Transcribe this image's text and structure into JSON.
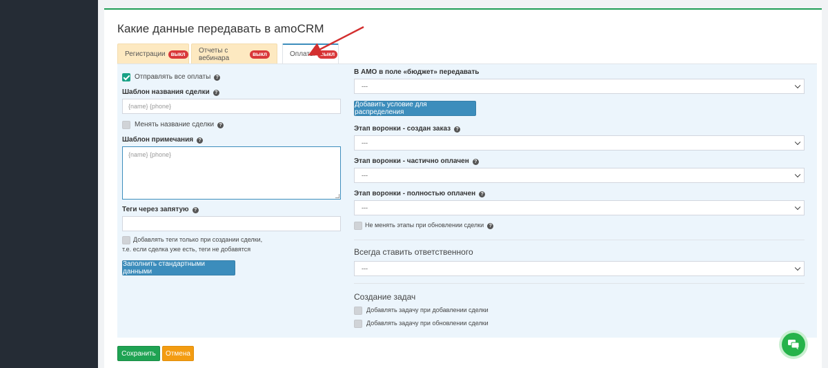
{
  "panel": {
    "title": "Какие данные передавать в amoCRM"
  },
  "tabs": [
    {
      "label": "Регистрации",
      "badge": "выкл"
    },
    {
      "label": "Отчеты с вебинара",
      "badge": "выкл"
    },
    {
      "label": "Оплаты",
      "badge": "выкл"
    }
  ],
  "left": {
    "send_all_payments": "Отправлять все оплаты",
    "deal_name_template_label": "Шаблон названия сделки",
    "deal_name_template_value": "{name} {phone}",
    "change_deal_name": "Менять название сделки",
    "note_template_label": "Шаблон примечания",
    "note_template_value": "{name} {phone}",
    "tags_label": "Теги через запятую",
    "tags_value": "",
    "add_tags_only_on_create_line1": "Добавлять теги только при создании сделки,",
    "add_tags_only_on_create_line2": "т.е. если сделка уже есть, теги не добавятся",
    "fill_default_button": "Заполнить стандартными данными"
  },
  "right": {
    "budget_label": "В АМО в поле «бюджет» передавать",
    "budget_value": "---",
    "add_condition_button": "Добавить условие для распределения",
    "stage_created_label": "Этап воронки - создан заказ",
    "stage_created_value": "---",
    "stage_partial_label": "Этап воронки - частично оплачен",
    "stage_partial_value": "---",
    "stage_full_label": "Этап воронки - полностью оплачен",
    "stage_full_value": "---",
    "dont_change_stages": "Не менять этапы при обновлении сделки",
    "responsible_title": "Всегда ставить ответственного",
    "responsible_value": "---",
    "tasks_title": "Создание задач",
    "task_on_add": "Добавлять задачу при добавлении сделки",
    "task_on_update": "Добавлять задачу при обновлении сделки"
  },
  "footer": {
    "save": "Сохранить",
    "cancel": "Отмена"
  },
  "colors": {
    "accent": "#3c8dbc",
    "save": "#1fa353",
    "cancel": "#f39c12",
    "badge": "#d9383a",
    "sidebar": "#252c35",
    "arrow": "#d32f2f"
  },
  "icons": {
    "help": "help-circle-icon",
    "chat": "chat-icon",
    "annotation": "red-arrow"
  }
}
